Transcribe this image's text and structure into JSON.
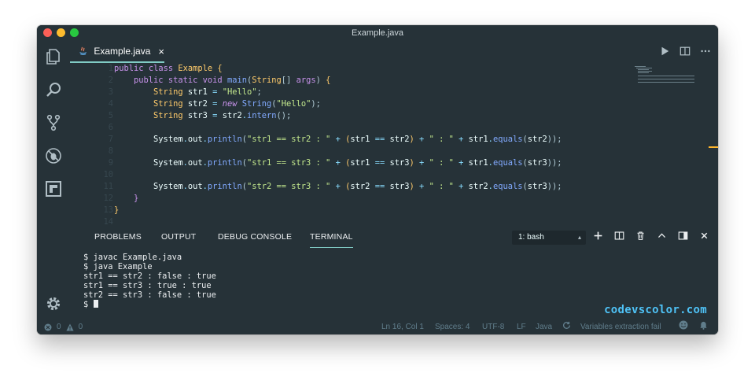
{
  "window": {
    "title": "Example.java"
  },
  "tab": {
    "label": "Example.java",
    "close": "×",
    "icon": "java-file-icon"
  },
  "activity_bar": [
    "explorer-icon",
    "search-icon",
    "source-control-icon",
    "debug-icon",
    "extensions-icon",
    "settings-gear-icon"
  ],
  "editor": {
    "lines": [
      "1",
      "2",
      "3",
      "4",
      "5",
      "6",
      "7",
      "8",
      "9",
      "10",
      "11",
      "12",
      "13",
      "14"
    ]
  },
  "panel": {
    "tabs": [
      "PROBLEMS",
      "OUTPUT",
      "DEBUG CONSOLE",
      "TERMINAL"
    ],
    "active_tab": "TERMINAL",
    "shell": "1: bash",
    "terminal_lines": [
      "$ javac Example.java",
      "$ java Example",
      "str1 == str2 : false : true",
      "str1 == str3 : true : true",
      "str2 == str3 : false : true"
    ],
    "prompt": "$ "
  },
  "watermark": "codevscolor.com",
  "status": {
    "errors": "0",
    "warnings": "0",
    "position": "Ln 16, Col 1",
    "spaces": "Spaces: 4",
    "encoding": "UTF-8",
    "eol": "LF",
    "language": "Java",
    "message": "Variables extraction fail"
  },
  "colors": {
    "background": "#263238",
    "accent": "#80cbc4",
    "keyword": "#c792ea",
    "string": "#c3e88d",
    "class": "#ffcb6b",
    "function": "#82aaff"
  }
}
